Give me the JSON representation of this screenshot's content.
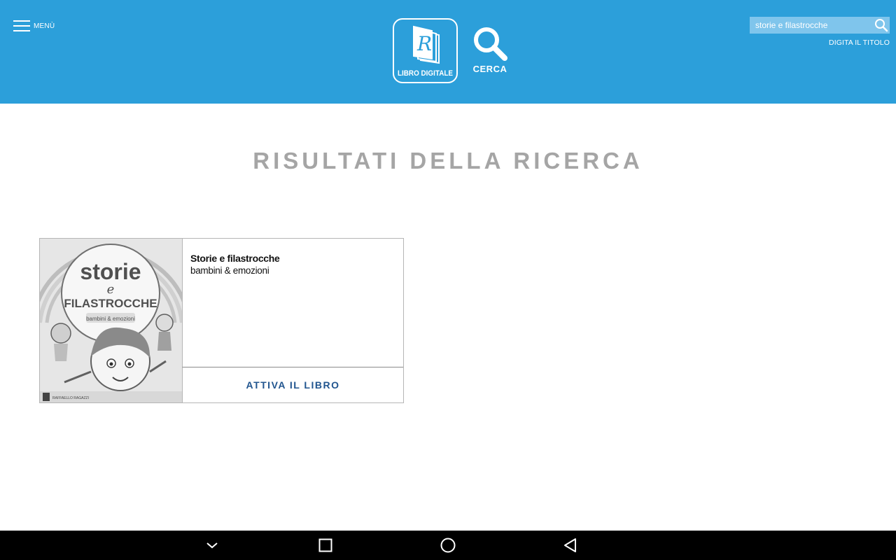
{
  "header": {
    "menu_label": "MENÙ",
    "logo_letter": "R",
    "logo_text": "LIBRO DIGITALE",
    "search_action_label": "CERCA",
    "search": {
      "value": "storie e filastrocche",
      "hint": "DIGITA IL TITOLO"
    },
    "background_color": "#2c9fda"
  },
  "main": {
    "title": "RISULTATI DELLA RICERCA",
    "results": [
      {
        "title": "Storie e filastrocche",
        "subtitle": "bambini & emozioni",
        "action_label": "ATTIVA IL LIBRO",
        "cover": {
          "title_top": "storie",
          "title_mid": "e",
          "title_bottom": "FILASTROCCHE",
          "subtitle": "bambini & emozioni",
          "publisher": "RAFFAELLO RAGAZZI"
        }
      }
    ]
  },
  "navbar": {
    "icons": [
      "chevron-down-icon",
      "recent-apps-icon",
      "home-icon",
      "back-icon"
    ]
  },
  "colors": {
    "title_gray": "#a5a5a5",
    "action_blue": "#21558f"
  }
}
